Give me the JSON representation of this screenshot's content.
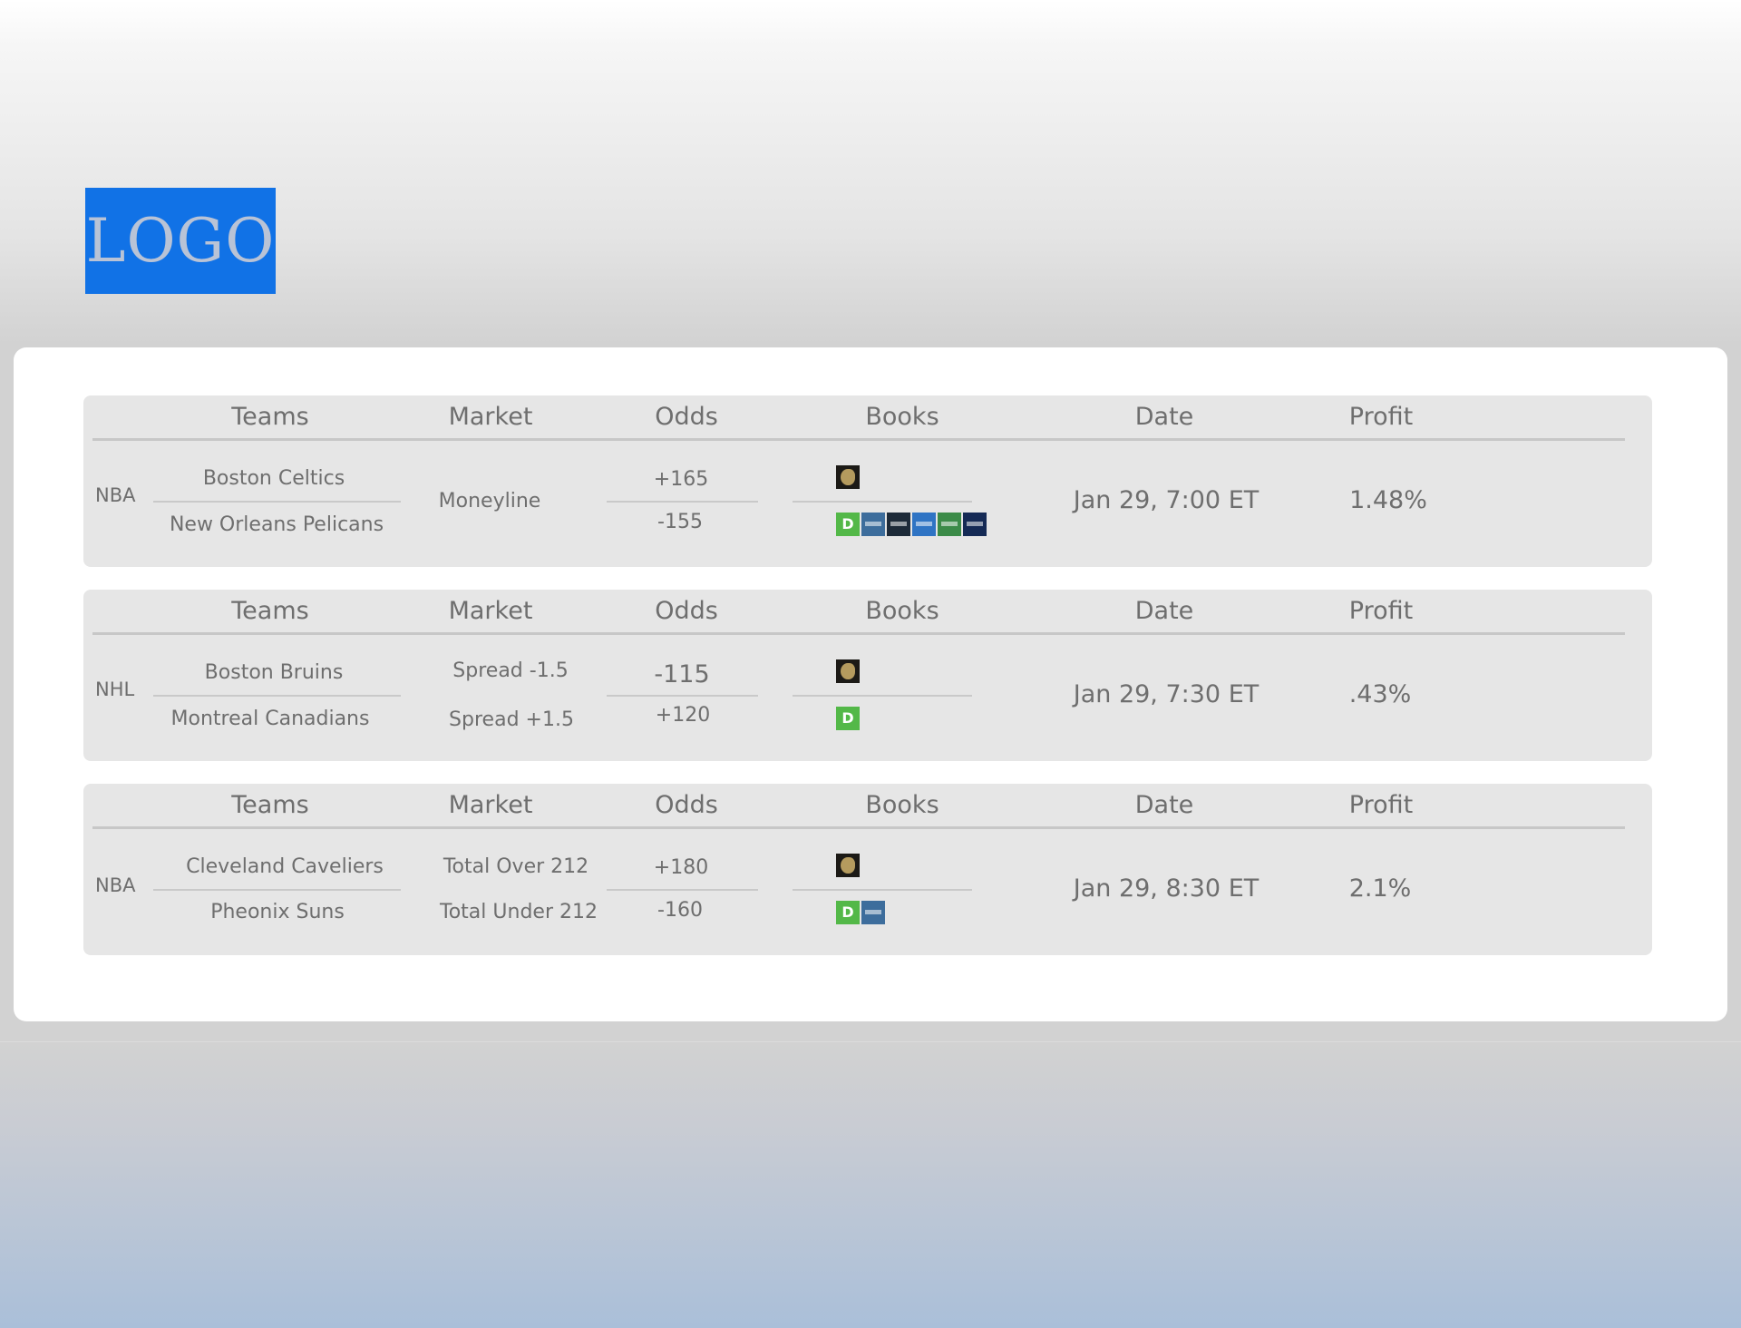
{
  "logo": {
    "text": "LOGO",
    "color": "#1172e6"
  },
  "headers": {
    "teams": "Teams",
    "market": "Market",
    "odds": "Odds",
    "books": "Books",
    "date": "Date",
    "profit": "Profit"
  },
  "bets": [
    {
      "league": "NBA",
      "team1": "Boston Celtics",
      "team2": "New Orleans Pelicans",
      "market1": "Moneyline",
      "market2": "",
      "odds1": "+165",
      "odds2": "-155",
      "books1": [
        "lion-book-icon"
      ],
      "books2": [
        "draftkings-icon",
        "sugarhouse-icon",
        "dark-book-icon",
        "blue-book-icon",
        "unibet-icon",
        "navy-book-icon"
      ],
      "date": "Jan 29, 7:00 ET",
      "profit": "1.48%"
    },
    {
      "league": "NHL",
      "team1": "Boston Bruins",
      "team2": "Montreal Canadians",
      "market1": "Spread -1.5",
      "market2": "Spread +1.5",
      "odds1": "-115",
      "odds2": "+120",
      "books1": [
        "lion-book-icon"
      ],
      "books2": [
        "draftkings-icon"
      ],
      "date": "Jan 29, 7:30 ET",
      "profit": ".43%"
    },
    {
      "league": "NBA",
      "team1": "Cleveland Caveliers",
      "team2": "Pheonix Suns",
      "market1": "Total Over 212",
      "market2": "Total Under 212",
      "odds1": "+180",
      "odds2": "-160",
      "books1": [
        "lion-book-icon"
      ],
      "books2": [
        "draftkings-icon",
        "sugarhouse-icon"
      ],
      "date": "Jan 29, 8:30 ET",
      "profit": "2.1%"
    }
  ]
}
